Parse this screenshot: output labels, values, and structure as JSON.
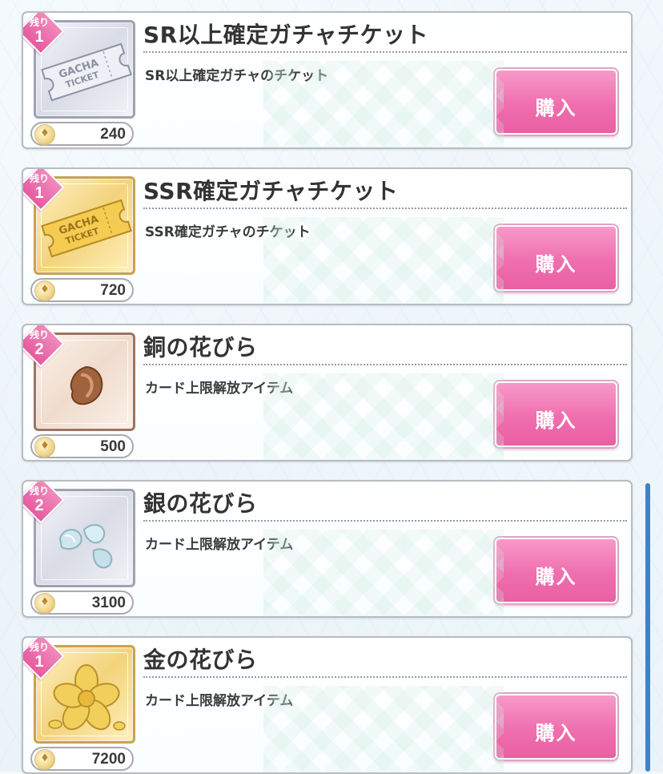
{
  "shop": {
    "items": [
      {
        "name": "SR以上確定ガチャチケット",
        "description": "SR以上確定ガチャのチケット",
        "remaining_label": "残り",
        "remaining": "1",
        "price": "240",
        "buy_label": "購入",
        "thumb_style": "silver",
        "icon": "gacha-ticket-silver-icon",
        "ticket_text_1": "GACHA",
        "ticket_text_2": "TICKET"
      },
      {
        "name": "SSR確定ガチャチケット",
        "description": "SSR確定ガチャのチケット",
        "remaining_label": "残り",
        "remaining": "1",
        "price": "720",
        "buy_label": "購入",
        "thumb_style": "gold",
        "icon": "gacha-ticket-gold-icon",
        "ticket_text_1": "GACHA",
        "ticket_text_2": "TICKET"
      },
      {
        "name": "銅の花びら",
        "description": "カード上限解放アイテム",
        "remaining_label": "残り",
        "remaining": "2",
        "price": "500",
        "buy_label": "購入",
        "thumb_style": "copper",
        "icon": "copper-petal-icon"
      },
      {
        "name": "銀の花びら",
        "description": "カード上限解放アイテム",
        "remaining_label": "残り",
        "remaining": "2",
        "price": "3100",
        "buy_label": "購入",
        "thumb_style": "silver",
        "icon": "silver-petals-icon"
      },
      {
        "name": "金の花びら",
        "description": "カード上限解放アイテム",
        "remaining_label": "残り",
        "remaining": "1",
        "price": "7200",
        "buy_label": "購入",
        "thumb_style": "gold",
        "icon": "gold-flower-icon"
      }
    ]
  },
  "colors": {
    "buy_button": "#ef6fae",
    "remaining_badge": "#e75a9f",
    "scrollbar": "#3f83c6"
  }
}
